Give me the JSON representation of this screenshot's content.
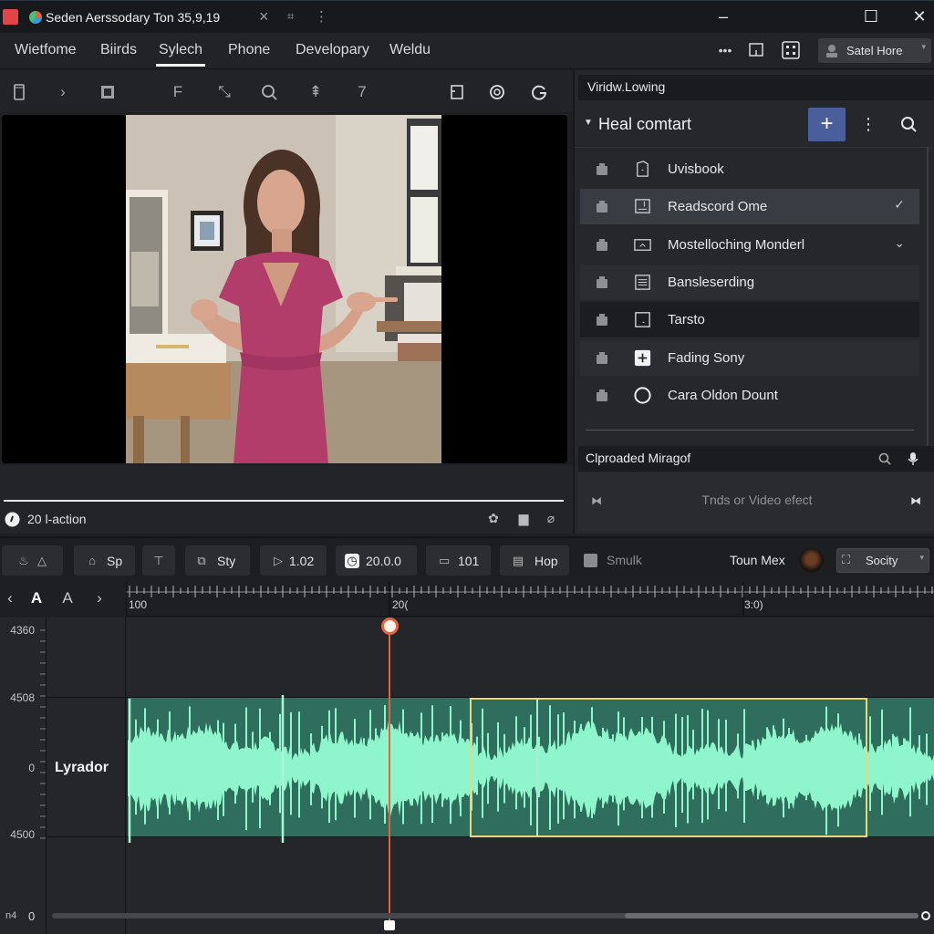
{
  "window": {
    "title": "Seden Aerssodary Ton 35,9,19",
    "controls": [
      "minimize",
      "maximize",
      "close"
    ]
  },
  "menu": {
    "items": [
      {
        "label": "Wietfome",
        "active": false
      },
      {
        "label": "Biirds",
        "active": false
      },
      {
        "label": "Sylech",
        "active": true
      },
      {
        "label": "Phone",
        "active": false
      },
      {
        "label": "Developary",
        "active": false
      },
      {
        "label": "Weldu",
        "active": false
      }
    ],
    "right_icons": [
      "more-icon",
      "panel-icon",
      "layout-grid-icon"
    ],
    "user": {
      "label": "Satel Hore"
    }
  },
  "tools": [
    "clip-icon",
    "chevron-right-icon",
    "film-icon",
    "text-tool-icon",
    "pen-tool-icon",
    "search-icon",
    "arrow-tool-icon",
    "crop-tool-icon",
    "export-icon",
    "copyright-icon",
    "refresh-icon"
  ],
  "preview": {
    "status_label": "20 l-action",
    "progress": 1.0
  },
  "right_panel": {
    "title": "Viridw.Lowing",
    "section_title": "Heal comtart",
    "add_label": "+",
    "items": [
      {
        "label": "Uvisbook",
        "icon": "document-icon",
        "trail": "",
        "state": "normal"
      },
      {
        "label": "Readscord Ome",
        "icon": "frame-icon",
        "trail": "✓",
        "state": "selected"
      },
      {
        "label": "Mostelloching Monderl",
        "icon": "image-icon",
        "trail": "⌄",
        "state": "normal"
      },
      {
        "label": "Bansleserding",
        "icon": "list-icon",
        "trail": "",
        "state": "alt"
      },
      {
        "label": "Tarsto",
        "icon": "box-icon",
        "trail": "",
        "state": "dark"
      },
      {
        "label": "Fading Sony",
        "icon": "plus-box-icon",
        "trail": "",
        "state": "alt"
      },
      {
        "label": "Cara Oldon Dount",
        "icon": "circle-icon",
        "trail": "",
        "state": "normal"
      }
    ],
    "effects": {
      "title": "Clproaded Miragof",
      "hint": "Tnds or Video efect"
    }
  },
  "timeline_toolbar": {
    "buttons": [
      {
        "label": "",
        "icon": "mask-triangle-icon"
      },
      {
        "label": "Sp",
        "icon": "home-icon"
      },
      {
        "label": "",
        "icon": "text-t-icon"
      },
      {
        "label": "Sty",
        "icon": "style-icon"
      },
      {
        "label": "1.02",
        "icon": "play-icon"
      },
      {
        "label": "20.0.0",
        "icon": "clock-icon"
      },
      {
        "label": "101",
        "icon": "monitor-icon"
      },
      {
        "label": "Hop",
        "icon": "grid-icon"
      },
      {
        "label": "Smulk",
        "icon": "square-icon"
      }
    ],
    "track_user": "Toun Mex",
    "preset": {
      "label": "Socity"
    }
  },
  "timeline": {
    "ruler_labels": [
      "100",
      "20(",
      "3:0)"
    ],
    "y_labels": [
      "4360",
      "4508",
      "0",
      "4500"
    ],
    "track_name": "Lyrador",
    "bottom_left": "n4",
    "bottom_zero": "0",
    "playhead_value": 200,
    "scroll_position": 0.66
  },
  "colors": {
    "accent_blue": "#4b5e9c",
    "waveform_fill": "#8ef5cc",
    "waveform_bg": "#2f6e5c",
    "selection": "#e9d77c",
    "playhead": "#e2653f"
  }
}
